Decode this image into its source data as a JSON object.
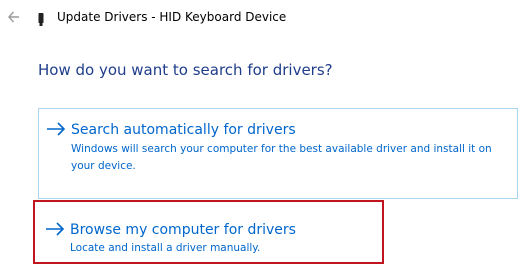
{
  "window": {
    "title": "Update Drivers - HID Keyboard Device",
    "back_icon": "back-arrow-icon",
    "device_icon": "usb-device-icon"
  },
  "main": {
    "heading": "How do you want to search for drivers?",
    "options": [
      {
        "title": "Search automatically for drivers",
        "description": "Windows will search your computer for the best available driver and install it on your device.",
        "icon": "right-arrow-icon"
      },
      {
        "title": "Browse my computer for drivers",
        "description": "Locate and install a driver manually.",
        "icon": "right-arrow-icon"
      }
    ]
  },
  "colors": {
    "link": "#0066cc",
    "heading": "#1f3d8a",
    "option_border": "#a9d6ee",
    "highlight": "#c0141f"
  }
}
